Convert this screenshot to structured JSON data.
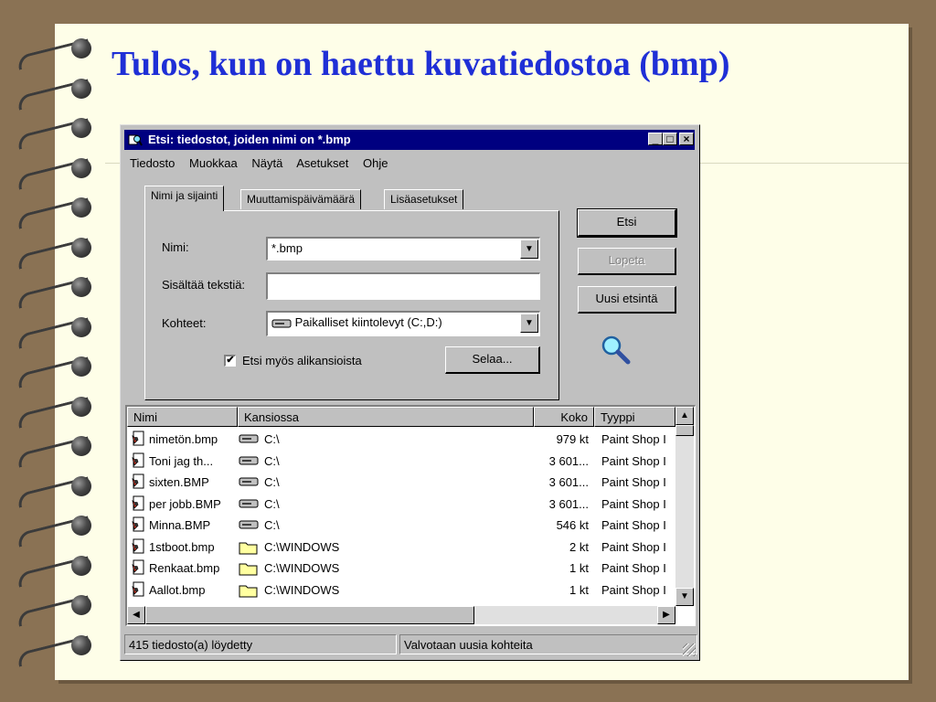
{
  "slide": {
    "title": "Tulos, kun on haettu kuvatiedostoa (bmp)"
  },
  "window": {
    "title": "Etsi:  tiedostot, joiden nimi on *.bmp",
    "controls": {
      "minimize": "_",
      "maximize": "□",
      "close": "×"
    }
  },
  "menu": [
    "Tiedosto",
    "Muokkaa",
    "Näytä",
    "Asetukset",
    "Ohje"
  ],
  "tabs": [
    "Nimi ja sijainti",
    "Muuttamispäivämäärä",
    "Lisäasetukset"
  ],
  "form": {
    "name_label": "Nimi:",
    "name_value": "*.bmp",
    "contains_label": "Sisältää tekstiä:",
    "contains_value": "",
    "target_label": "Kohteet:",
    "target_value": "Paikalliset kiintolevyt (C:,D:)",
    "subfolders_label": "Etsi myös alikansioista",
    "subfolders_checked": "✔",
    "browse_button": "Selaa..."
  },
  "buttons": {
    "find": "Etsi",
    "stop": "Lopeta",
    "new_search": "Uusi etsintä"
  },
  "results": {
    "columns": [
      "Nimi",
      "Kansiossa",
      "Koko",
      "Tyyppi"
    ],
    "rows": [
      {
        "name": "nimetön.bmp",
        "folder": "C:\\",
        "folder_icon": "drive",
        "size": "979 kt",
        "type": "Paint Shop I"
      },
      {
        "name": "Toni jag th...",
        "folder": "C:\\",
        "folder_icon": "drive",
        "size": "3 601...",
        "type": "Paint Shop I"
      },
      {
        "name": "sixten.BMP",
        "folder": "C:\\",
        "folder_icon": "drive",
        "size": "3 601...",
        "type": "Paint Shop I"
      },
      {
        "name": "per jobb.BMP",
        "folder": "C:\\",
        "folder_icon": "drive",
        "size": "3 601...",
        "type": "Paint Shop I"
      },
      {
        "name": "Minna.BMP",
        "folder": "C:\\",
        "folder_icon": "drive",
        "size": "546 kt",
        "type": "Paint Shop I"
      },
      {
        "name": "1stboot.bmp",
        "folder": "C:\\WINDOWS",
        "folder_icon": "folder",
        "size": "2 kt",
        "type": "Paint Shop I"
      },
      {
        "name": "Renkaat.bmp",
        "folder": "C:\\WINDOWS",
        "folder_icon": "folder",
        "size": "1 kt",
        "type": "Paint Shop I"
      },
      {
        "name": "Aallot.bmp",
        "folder": "C:\\WINDOWS",
        "folder_icon": "folder",
        "size": "1 kt",
        "type": "Paint Shop I"
      }
    ]
  },
  "status": {
    "left": "415 tiedosto(a) löydetty",
    "right": "Valvotaan uusia kohteita"
  },
  "colors": {
    "title_text": "#1f2fd6",
    "titlebar": "#000080",
    "window_face": "#c0c0c0",
    "paper": "#fefee8",
    "background": "#8a7254"
  }
}
